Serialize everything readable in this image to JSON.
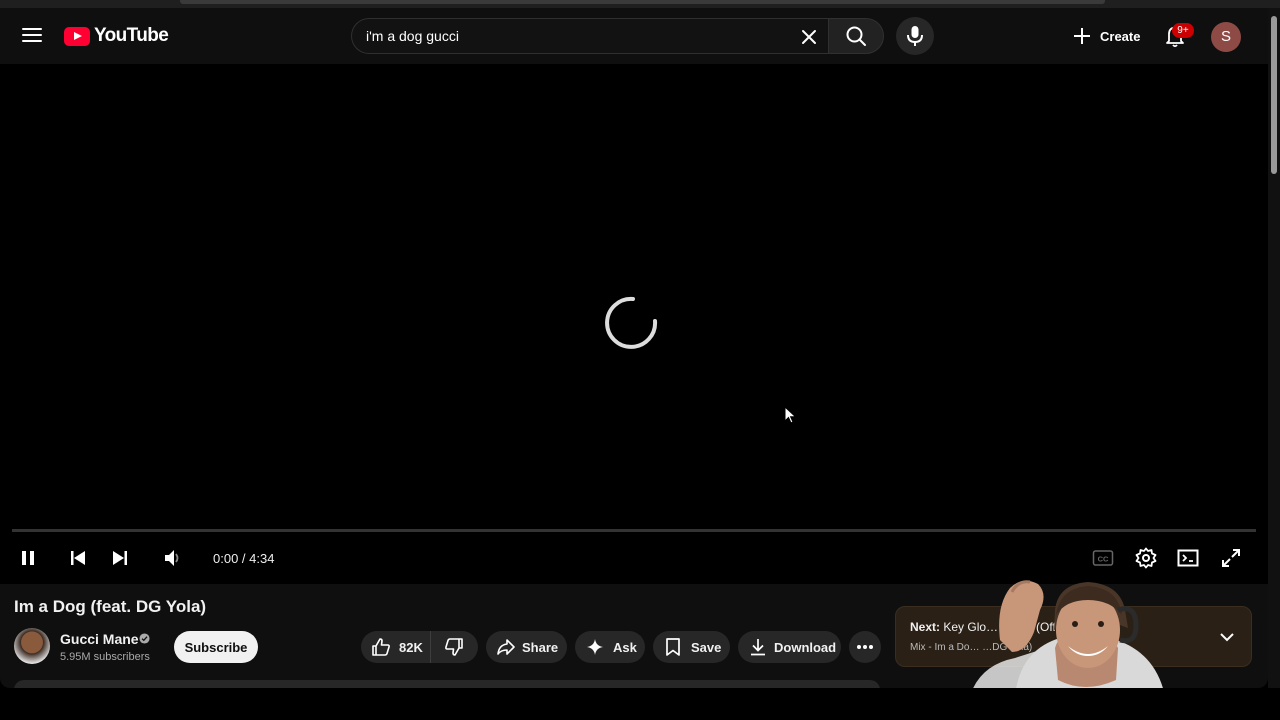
{
  "masthead": {
    "logo_text": "YouTube",
    "search_value": "i'm a dog gucci",
    "search_placeholder": "Search",
    "create_label": "Create",
    "notifications_badge": "9+",
    "avatar_letter": "S"
  },
  "player": {
    "time_current": "0:00",
    "time_separator": " / ",
    "time_total": "4:34",
    "progress_fraction": 0.0,
    "state": "loading"
  },
  "video": {
    "title": "Im a Dog (feat. DG Yola)",
    "channel_name": "Gucci Mane",
    "subscribers": "5.95M subscribers",
    "subscribe_label": "Subscribe",
    "likes": "82K",
    "share_label": "Share",
    "ask_label": "Ask",
    "save_label": "Save",
    "download_label": "Download"
  },
  "up_next": {
    "prefix": "Next:",
    "title": "Key Glo… …oco (Offi… …eo)",
    "subtitle": "Mix - Im a Do… …DG Yola)"
  },
  "icons": {
    "menu": "menu-icon",
    "search": "search-icon",
    "clear": "close-icon",
    "mic": "microphone-icon",
    "create": "plus-icon",
    "notifications": "bell-icon",
    "pause": "pause-icon",
    "previous": "skip-previous-icon",
    "next": "skip-next-icon",
    "volume": "volume-icon",
    "captions": "cc-icon",
    "settings": "gear-icon",
    "miniplayer": "miniplayer-icon",
    "fullscreen": "fullscreen-icon",
    "like": "thumbs-up-icon",
    "dislike": "thumbs-down-icon",
    "share": "share-arrow-icon",
    "ask": "sparkle-icon",
    "save": "bookmark-icon",
    "download": "download-icon",
    "more": "more-horizontal-icon",
    "expand": "chevron-down-icon"
  },
  "colors": {
    "page_bg": "#0f0f0f",
    "brand_red": "#ff0033",
    "pill_bg": "#272727",
    "next_card_bg": "#2a2016"
  }
}
